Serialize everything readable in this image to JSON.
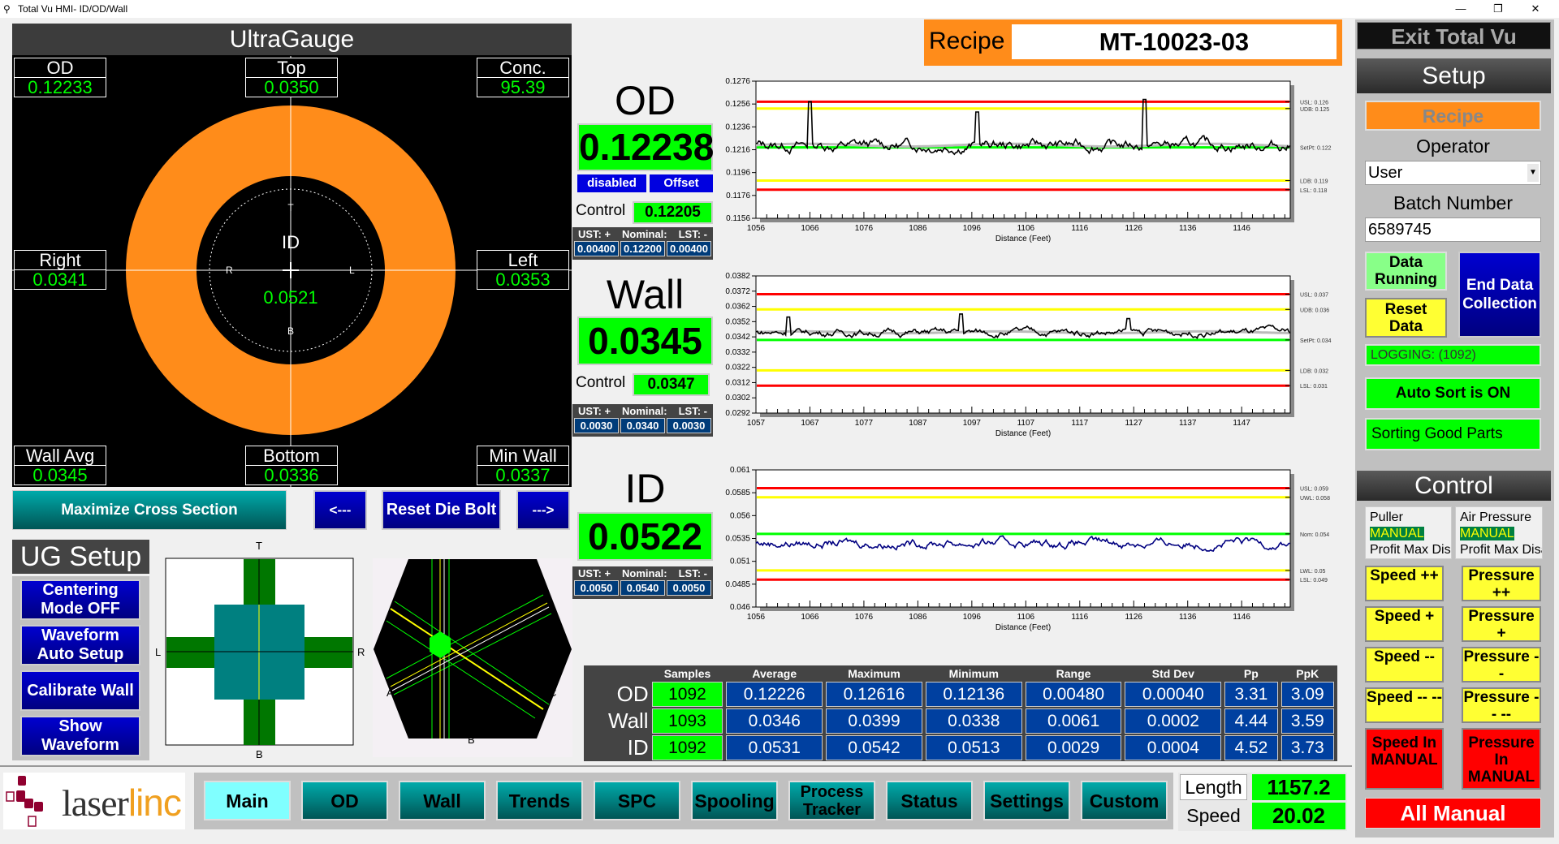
{
  "window": {
    "title": "Total Vu HMI- ID/OD/Wall",
    "min": "—",
    "restore": "❐",
    "close": "✕"
  },
  "ultragauge": {
    "title": "UltraGauge",
    "od": {
      "label": "OD",
      "value": "0.12233"
    },
    "top": {
      "label": "Top",
      "value": "0.0350"
    },
    "conc": {
      "label": "Conc.",
      "value": "95.39"
    },
    "right": {
      "label": "Right",
      "value": "0.0341"
    },
    "left": {
      "label": "Left",
      "value": "0.0353"
    },
    "wall_avg": {
      "label": "Wall Avg",
      "value": "0.0345"
    },
    "bottom": {
      "label": "Bottom",
      "value": "0.0336"
    },
    "min_wall": {
      "label": "Min Wall",
      "value": "0.0337"
    },
    "center_label": "ID",
    "center_value": "0.0521",
    "marks": {
      "t": "T",
      "b": "B",
      "r": "R",
      "l": "L"
    }
  },
  "ug_buttons": {
    "maximize": "Maximize Cross Section",
    "prev": "<---",
    "reset": "Reset Die Bolt",
    "next": "--->"
  },
  "ug_setup": {
    "title": "UG Setup",
    "centering": "Centering Mode OFF",
    "waveform_auto": "Waveform Auto Setup",
    "calibrate": "Calibrate Wall",
    "show_waveform": "Show Waveform"
  },
  "cross": {
    "t": "T",
    "b": "B",
    "l": "L",
    "r": "R"
  },
  "hex": {
    "a": "A",
    "b": "B",
    "c": "C"
  },
  "recipe": {
    "label": "Recipe",
    "value": "MT-10023-03"
  },
  "od": {
    "title": "OD",
    "value": "0.12238",
    "disabled": "disabled",
    "offset": "Offset",
    "control_label": "Control",
    "control": "0.12205",
    "ust_label": "UST: +",
    "nom_label": "Nominal:",
    "lst_label": "LST: -",
    "ust": "0.00400",
    "nom": "0.12200",
    "lst": "0.00400"
  },
  "wall": {
    "title": "Wall",
    "value": "0.0345",
    "control_label": "Control",
    "control": "0.0347",
    "ust_label": "UST: +",
    "nom_label": "Nominal:",
    "lst_label": "LST: -",
    "ust": "0.0030",
    "nom": "0.0340",
    "lst": "0.0030"
  },
  "id": {
    "title": "ID",
    "value": "0.0522",
    "ust_label": "UST: +",
    "nom_label": "Nominal:",
    "lst_label": "LST: -",
    "ust": "0.0050",
    "nom": "0.0540",
    "lst": "0.0050"
  },
  "chart_data": [
    {
      "type": "line",
      "name": "od",
      "xlabel": "Distance (Feet)",
      "xlim": [
        1056,
        1155
      ],
      "xticks": [
        "1056",
        "1066",
        "1076",
        "1086",
        "1096",
        "1106",
        "1116",
        "1126",
        "1136",
        "1146"
      ],
      "ylim": [
        0.1156,
        0.1276
      ],
      "yticks": [
        "0.1276",
        "0.1256",
        "0.1236",
        "0.1216",
        "0.1196",
        "0.1176",
        "0.1156"
      ],
      "base": 0.122,
      "noise": 0.0004,
      "spikes": [
        [
          1066,
          0.1258
        ],
        [
          1097,
          0.1249
        ],
        [
          1128,
          0.126
        ]
      ],
      "trace_color": "#000000",
      "limits": [
        {
          "label": "USL: 0.126",
          "value": 0.1258,
          "color": "#ff0000"
        },
        {
          "label": "UDB: 0.125",
          "value": 0.1252,
          "color": "#ffff00"
        },
        {
          "label": "SetPt: 0.122",
          "value": 0.1218,
          "color": "#00ff00"
        },
        {
          "label": "LDB: 0.119",
          "value": 0.1189,
          "color": "#ffff00"
        },
        {
          "label": "LSL: 0.118",
          "value": 0.1181,
          "color": "#ff0000"
        }
      ]
    },
    {
      "type": "line",
      "name": "wall",
      "xlabel": "Distance (Feet)",
      "xlim": [
        1057,
        1156
      ],
      "xticks": [
        "1057",
        "1067",
        "1077",
        "1087",
        "1097",
        "1107",
        "1117",
        "1127",
        "1137",
        "1147"
      ],
      "ylim": [
        0.0292,
        0.0382
      ],
      "yticks": [
        "0.0382",
        "0.0372",
        "0.0362",
        "0.0352",
        "0.0342",
        "0.0332",
        "0.0322",
        "0.0312",
        "0.0302",
        "0.0292"
      ],
      "base": 0.0345,
      "noise": 0.0002,
      "spikes": [
        [
          1063,
          0.0355
        ],
        [
          1095,
          0.0357
        ],
        [
          1126,
          0.0354
        ]
      ],
      "trace_color": "#000000",
      "limits": [
        {
          "label": "USL: 0.037",
          "value": 0.037,
          "color": "#ff0000"
        },
        {
          "label": "UDB: 0.036",
          "value": 0.036,
          "color": "#ffff00"
        },
        {
          "label": "SetPt: 0.034",
          "value": 0.034,
          "color": "#00ff00"
        },
        {
          "label": "LDB: 0.032",
          "value": 0.032,
          "color": "#ffff00"
        },
        {
          "label": "LSL: 0.031",
          "value": 0.031,
          "color": "#ff0000"
        }
      ]
    },
    {
      "type": "line",
      "name": "id",
      "xlabel": "Distance (Feet)",
      "xlim": [
        1056,
        1155
      ],
      "xticks": [
        "1056",
        "1066",
        "1076",
        "1086",
        "1096",
        "1106",
        "1116",
        "1126",
        "1136",
        "1146"
      ],
      "ylim": [
        0.046,
        0.061
      ],
      "yticks": [
        "0.061",
        "0.0585",
        "0.056",
        "0.0535",
        "0.051",
        "0.0485",
        "0.046"
      ],
      "base": 0.053,
      "noise": 0.0004,
      "spikes": [],
      "trace_color": "#000080",
      "limits": [
        {
          "label": "USL: 0.059",
          "value": 0.059,
          "color": "#ff0000"
        },
        {
          "label": "UWL: 0.058",
          "value": 0.058,
          "color": "#ffff00"
        },
        {
          "label": "Nom: 0.054",
          "value": 0.054,
          "color": "#00ff00"
        },
        {
          "label": "LWL: 0.05",
          "value": 0.05,
          "color": "#ffff00"
        },
        {
          "label": "LSL: 0.049",
          "value": 0.049,
          "color": "#ff0000"
        }
      ]
    }
  ],
  "stats": {
    "headers": [
      "Samples",
      "Average",
      "Maximum",
      "Minimum",
      "Range",
      "Std Dev",
      "Pp",
      "PpK"
    ],
    "rows": [
      {
        "label": "OD",
        "cells": [
          "1092",
          "0.12226",
          "0.12616",
          "0.12136",
          "0.00480",
          "0.00040",
          "3.31",
          "3.09"
        ]
      },
      {
        "label": "Wall",
        "cells": [
          "1093",
          "0.0346",
          "0.0399",
          "0.0338",
          "0.0061",
          "0.0002",
          "4.44",
          "3.59"
        ]
      },
      {
        "label": "ID",
        "cells": [
          "1092",
          "0.0531",
          "0.0542",
          "0.0513",
          "0.0029",
          "0.0004",
          "4.52",
          "3.73"
        ]
      }
    ]
  },
  "setup": {
    "exit": "Exit Total Vu",
    "title": "Setup",
    "recipe": "Recipe",
    "operator_label": "Operator",
    "operator": "User",
    "batch_label": "Batch Number",
    "batch": "6589745",
    "data_running": "Data Running",
    "end_data": "End Data Collection",
    "reset_data": "Reset Data",
    "logging": "LOGGING: (1092)",
    "auto_sort": "Auto Sort is ON",
    "sorting": "Sorting Good Parts"
  },
  "control": {
    "title": "Control",
    "puller": "Puller",
    "puller_mode": "MANUAL",
    "puller_status": "Profit Max Disabled",
    "air": "Air Pressure",
    "air_mode": "MANUAL",
    "air_status": "Profit Max Disabled",
    "speed": [
      "Speed ++",
      "Speed +",
      "Speed --",
      "Speed -- --",
      "Speed In MANUAL"
    ],
    "pressure": [
      "Pressure ++",
      "Pressure +",
      "Pressure --",
      "Pressure -- --",
      "Pressure In MANUAL"
    ],
    "all_manual": "All Manual"
  },
  "logo": {
    "text1": "laser",
    "text2": "linc"
  },
  "nav": [
    "Main",
    "OD",
    "Wall",
    "Trends",
    "SPC",
    "Spooling",
    "Process Tracker",
    "Status",
    "Settings",
    "Custom"
  ],
  "line": {
    "length_label": "Length",
    "length": "1157.2",
    "speed_label": "Speed",
    "speed": "20.02"
  }
}
